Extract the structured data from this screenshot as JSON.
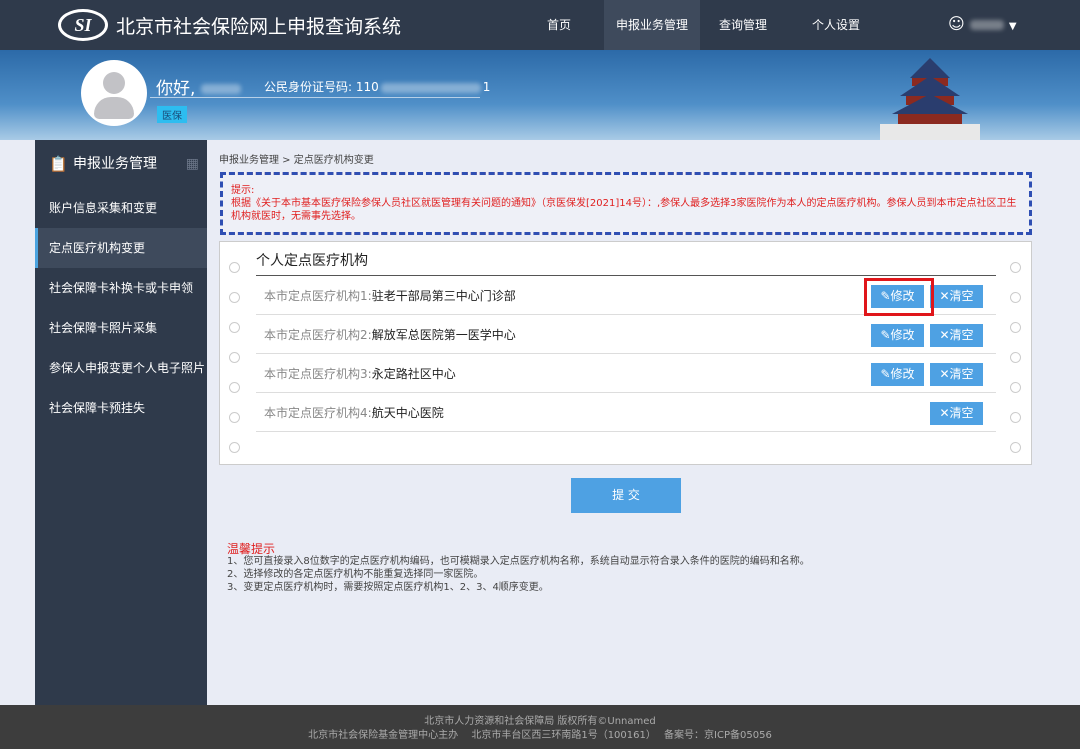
{
  "header": {
    "logo": "SI",
    "title": "北京市社会保险网上申报查询系统",
    "nav": [
      "首页",
      "申报业务管理",
      "查询管理",
      "个人设置"
    ],
    "active_nav": 1
  },
  "banner": {
    "greeting": "你好,",
    "id_label": "公民身份证号码: 110",
    "id_suffix": "1",
    "tag": "医保"
  },
  "sidebar": {
    "title": "申报业务管理",
    "items": [
      "账户信息采集和变更",
      "定点医疗机构变更",
      "社会保障卡补换卡或卡申领",
      "社会保障卡照片采集",
      "参保人申报变更个人电子照片",
      "社会保障卡预挂失"
    ],
    "active": 1
  },
  "breadcrumb": "申报业务管理 > 定点医疗机构变更",
  "tip": {
    "title": "提示:",
    "text": "根据《关于本市基本医疗保险参保人员社区就医管理有关问题的通知》（京医保发[2021]14号）：,参保人最多选择3家医院作为本人的定点医疗机构。参保人员到本市定点社区卫生机构就医时，无需事先选择。"
  },
  "card": {
    "title": "个人定点医疗机构",
    "rows": [
      {
        "label": "本市定点医疗机构1:",
        "value": "驻老干部局第三中心门诊部"
      },
      {
        "label": "本市定点医疗机构2:",
        "value": "解放军总医院第一医学中心"
      },
      {
        "label": "本市定点医疗机构3:",
        "value": "永定路社区中心"
      },
      {
        "label": "本市定点医疗机构4:",
        "value": "航天中心医院"
      }
    ],
    "edit_label": "修改",
    "clear_label": "清空"
  },
  "submit_label": "提 交",
  "warm": {
    "title": "温馨提示",
    "notes": [
      "1、您可直接录入8位数字的定点医疗机构编码，也可模糊录入定点医疗机构名称，系统自动显示符合录入条件的医院的编码和名称。",
      "2、选择修改的各定点医疗机构不能重复选择同一家医院。",
      "3、变更定点医疗机构时，需要按照定点医疗机构1、2、3、4顺序变更。"
    ]
  },
  "footer": {
    "line1": "北京市人力资源和社会保障局 版权所有©Unnamed",
    "line2": "北京市社会保险基金管理中心主办　 北京市丰台区西三环南路1号（100161）　 备案号：京ICP备05056"
  }
}
